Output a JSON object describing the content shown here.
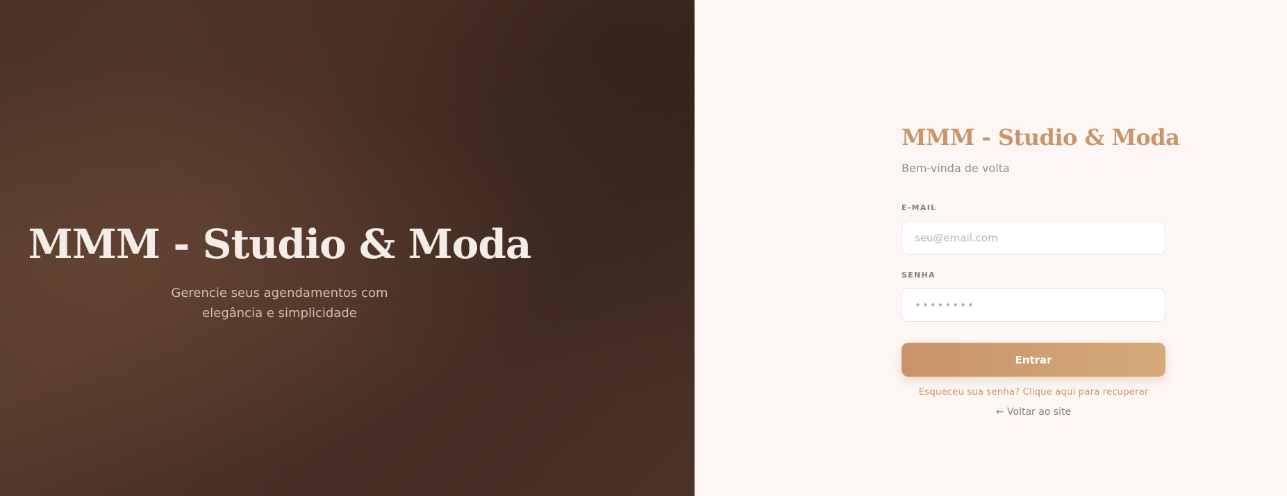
{
  "hero": {
    "title": "MMM - Studio & Moda",
    "subtitle_line1": "Gerencie seus agendamentos com",
    "subtitle_line2": "elegância e simplicidade"
  },
  "login": {
    "title": "MMM - Studio & Moda",
    "subtitle": "Bem-vinda de volta",
    "email": {
      "label": "E-MAIL",
      "placeholder": "seu@email.com",
      "value": ""
    },
    "password": {
      "label": "SENHA",
      "placeholder": "••••••••",
      "value": ""
    },
    "submit_label": "Entrar",
    "forgot_link": "Esqueceu sua senha? Clique aqui para recuperar",
    "back_link": "← Voltar ao site"
  },
  "colors": {
    "accent": "#c9956a",
    "hero_background": "#4a3328",
    "panel_background": "#fcf7f5"
  }
}
